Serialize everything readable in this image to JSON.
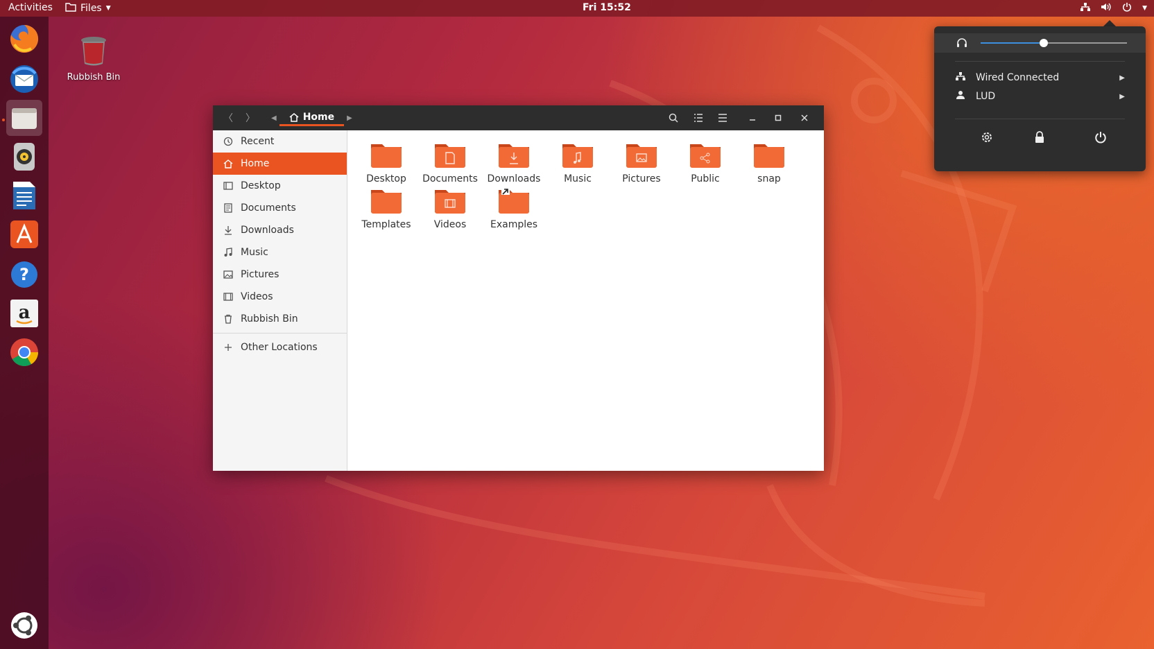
{
  "topbar": {
    "activities": "Activities",
    "app_menu": "Files",
    "clock": "Fri 15:52"
  },
  "dock": {
    "items": [
      {
        "icon": "firefox-icon"
      },
      {
        "icon": "thunderbird-icon"
      },
      {
        "icon": "files-icon",
        "active": true
      },
      {
        "icon": "rhythmbox-icon"
      },
      {
        "icon": "libreoffice-writer-icon"
      },
      {
        "icon": "software-center-icon"
      },
      {
        "icon": "help-icon"
      },
      {
        "icon": "amazon-icon"
      },
      {
        "icon": "chrome-icon"
      }
    ],
    "show_apps_icon": "ubuntu-show-apps-icon"
  },
  "desktop": {
    "trash_label": "Rubbish Bin"
  },
  "window": {
    "breadcrumb": "Home",
    "sidebar": [
      {
        "label": "Recent",
        "icon": "recent-icon"
      },
      {
        "label": "Home",
        "icon": "home-icon",
        "selected": true
      },
      {
        "label": "Desktop",
        "icon": "desktop-icon"
      },
      {
        "label": "Documents",
        "icon": "documents-icon"
      },
      {
        "label": "Downloads",
        "icon": "downloads-icon"
      },
      {
        "label": "Music",
        "icon": "music-icon"
      },
      {
        "label": "Pictures",
        "icon": "pictures-icon"
      },
      {
        "label": "Videos",
        "icon": "videos-icon"
      },
      {
        "label": "Rubbish Bin",
        "icon": "trash-icon"
      }
    ],
    "other_locations": "Other Locations",
    "folders": [
      {
        "label": "Desktop",
        "glyph": ""
      },
      {
        "label": "Documents",
        "glyph": "doc"
      },
      {
        "label": "Downloads",
        "glyph": "down"
      },
      {
        "label": "Music",
        "glyph": "music"
      },
      {
        "label": "Pictures",
        "glyph": "pic"
      },
      {
        "label": "Public",
        "glyph": "share"
      },
      {
        "label": "snap",
        "glyph": ""
      },
      {
        "label": "Templates",
        "glyph": ""
      },
      {
        "label": "Videos",
        "glyph": "video"
      },
      {
        "label": "Examples",
        "glyph": "link"
      }
    ]
  },
  "system_menu": {
    "volume": 0.43,
    "network_label": "Wired Connected",
    "user_label": "LUD"
  },
  "colors": {
    "accent": "#e95420",
    "folder": "#f26a35",
    "headerbar": "#2d2d2d"
  }
}
